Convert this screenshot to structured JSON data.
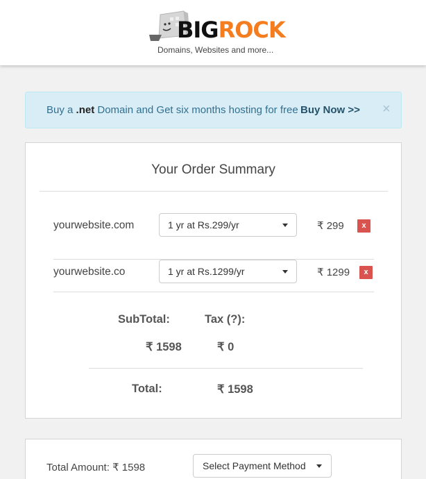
{
  "header": {
    "brand_part1": "BIG",
    "brand_part2": "ROCK",
    "tagline": "Domains, Websites and more..."
  },
  "promo": {
    "text_prefix": "Buy a ",
    "text_bold": ".net",
    "text_suffix": " Domain and Get six months hosting for free",
    "link": "Buy Now >>",
    "close": "×"
  },
  "order": {
    "title": "Your Order Summary",
    "items": [
      {
        "domain": "yourwebsite.com",
        "plan": "1 yr at Rs.299/yr",
        "price": "₹ 299",
        "remove": "x"
      },
      {
        "domain": "yourwebsite.co",
        "plan": "1 yr at Rs.1299/yr",
        "price": "₹ 1299",
        "remove": "x"
      }
    ],
    "subtotal_label": "SubTotal:",
    "tax_label": "Tax (?):",
    "subtotal_value": "₹ 1598",
    "tax_value": "₹ 0",
    "total_label": "Total:",
    "total_value": "₹ 1598"
  },
  "payment": {
    "amount_label": "Total Amount: ₹ 1598",
    "select_label": "Select Payment Method"
  },
  "colors": {
    "brand_orange": "#f47d20",
    "remove_red": "#d9534f",
    "promo_bg": "#d9edf7"
  }
}
